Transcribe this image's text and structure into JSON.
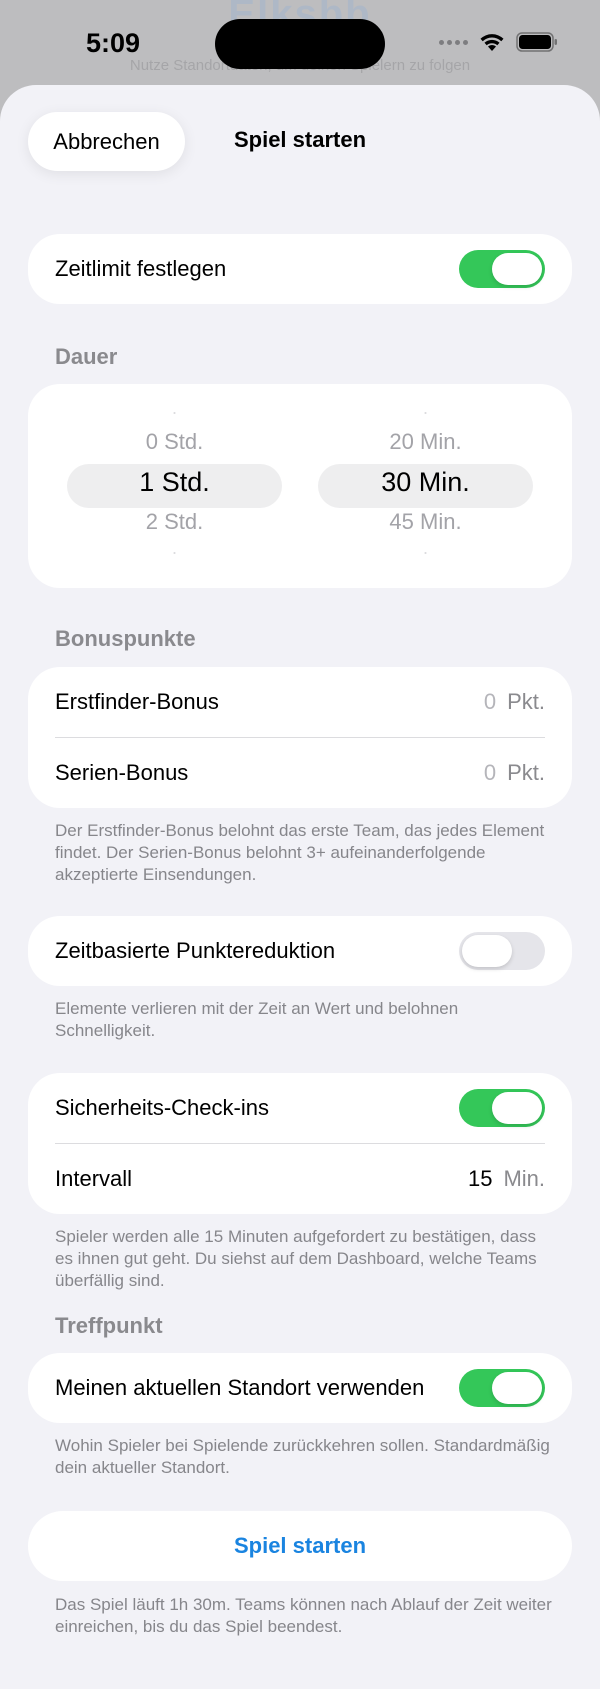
{
  "background": {
    "ghost_title": "Elksbb",
    "ghost_subtitle": "Nutze Standortdaten, um deinen Spielern zu folgen"
  },
  "status_bar": {
    "time": "5:09"
  },
  "nav": {
    "cancel_label": "Abbrechen",
    "title": "Spiel starten"
  },
  "time_limit": {
    "label": "Zeitlimit festlegen",
    "enabled": true
  },
  "duration": {
    "header": "Dauer",
    "hours": {
      "above": "0 Std.",
      "selected": "1 Std.",
      "below": "2 Std."
    },
    "minutes": {
      "above": "20 Min.",
      "selected": "30 Min.",
      "below": "45 Min."
    }
  },
  "bonus": {
    "header": "Bonuspunkte",
    "first_finder": {
      "label": "Erstfinder-Bonus",
      "value": "0",
      "unit": "Pkt."
    },
    "streak": {
      "label": "Serien-Bonus",
      "value": "0",
      "unit": "Pkt."
    },
    "footnote": "Der Erstfinder-Bonus belohnt das erste Team, das jedes Element findet. Der Serien-Bonus belohnt 3+ aufeinanderfolgende akzeptierte Einsendungen."
  },
  "decay": {
    "label": "Zeitbasierte Punktereduktion",
    "enabled": false,
    "footnote": "Elemente verlieren mit der Zeit an Wert und belohnen Schnelligkeit."
  },
  "safety": {
    "label": "Sicherheits-Check-ins",
    "enabled": true,
    "interval_label": "Intervall",
    "interval_value": "15",
    "interval_unit": "Min.",
    "footnote": "Spieler werden alle 15 Minuten aufgefordert zu bestätigen, dass es ihnen gut geht. Du siehst auf dem Dashboard, welche Teams überfällig sind."
  },
  "meeting_point": {
    "header": "Treffpunkt",
    "label": "Meinen aktuellen Standort verwenden",
    "enabled": true,
    "footnote": "Wohin Spieler bei Spielende zurückkehren sollen. Standardmäßig dein aktueller Standort."
  },
  "start": {
    "button_label": "Spiel starten",
    "footnote": "Das Spiel läuft 1h 30m. Teams können nach Ablauf der Zeit weiter einreichen, bis du das Spiel beendest."
  },
  "colors": {
    "accent": "#1a84e0",
    "toggle_on": "#34c759",
    "toggle_off": "#e5e5ea",
    "sheet_bg": "#f2f2f7"
  }
}
